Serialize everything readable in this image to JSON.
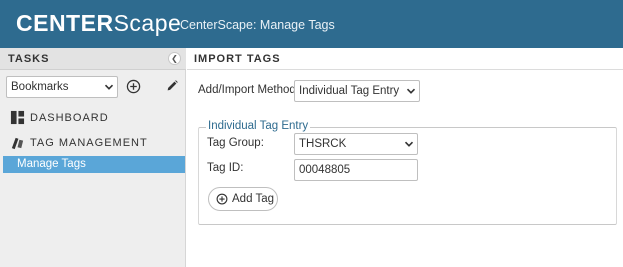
{
  "header": {
    "logo_bold": "CENTER",
    "logo_light": "Scape",
    "title": "CenterScape: Manage Tags"
  },
  "sidebar": {
    "title": "TASKS",
    "collapse_icon": "chevron-left-icon",
    "bookmarks": {
      "selected": "Bookmarks"
    },
    "items": [
      {
        "label": "DASHBOARD",
        "icon": "dashboard-icon"
      },
      {
        "label": "TAG MANAGEMENT",
        "icon": "tag-management-icon"
      }
    ],
    "sub_items": [
      {
        "label": "Manage Tags",
        "active": true
      }
    ]
  },
  "main": {
    "title": "IMPORT TAGS",
    "method_label": "Add/Import Method:",
    "method_value": "Individual Tag Entry",
    "fieldset": {
      "legend": "Individual Tag Entry",
      "group_label": "Tag Group:",
      "group_value": "THSRCK",
      "tagid_label": "Tag ID:",
      "tagid_value": "00048805",
      "add_button": "Add Tag"
    }
  },
  "colors": {
    "header_bg": "#2e6b8f",
    "active_item_bg": "#5aa6d8",
    "legend_text": "#2e6b8f"
  }
}
